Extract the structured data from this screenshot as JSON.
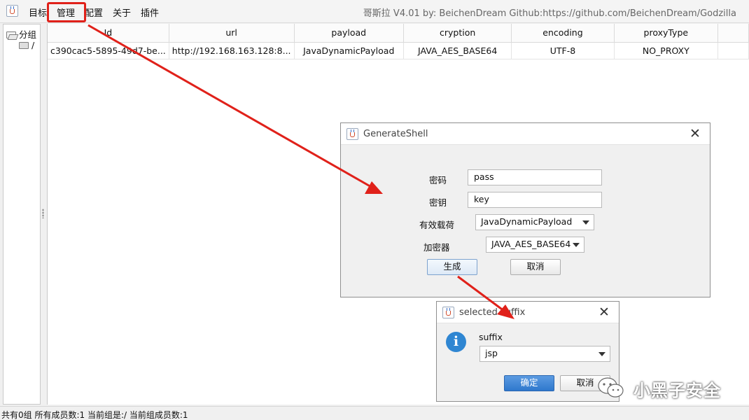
{
  "menubar": {
    "items": [
      "目标",
      "管理",
      "配置",
      "关于",
      "插件"
    ],
    "title_info": "哥斯拉    V4.01 by: BeichenDream Github:https://github.com/BeichenDream/Godzilla"
  },
  "tree": {
    "root": "分组",
    "child": "/"
  },
  "table": {
    "columns": [
      "Id",
      "url",
      "payload",
      "cryption",
      "encoding",
      "proxyType"
    ],
    "rows": [
      [
        "c390cac5-5895-49d7-be...",
        "http://192.168.163.128:8...",
        "JavaDynamicPayload",
        "JAVA_AES_BASE64",
        "UTF-8",
        "NO_PROXY"
      ]
    ]
  },
  "status": "共有0组 所有成员数:1 当前组是:/ 当前组成员数:1",
  "generate_dialog": {
    "title": "GenerateShell",
    "password_label": "密码",
    "password_value": "pass",
    "key_label": "密钥",
    "key_value": "key",
    "payload_label": "有效载荷",
    "payload_value": "JavaDynamicPayload",
    "cryption_label": "加密器",
    "cryption_value": "JAVA_AES_BASE64",
    "generate_button": "生成",
    "cancel_button": "取消"
  },
  "suffix_dialog": {
    "title": "selected suffix",
    "label": "suffix",
    "value": "jsp",
    "ok_button": "确定",
    "cancel_button": "取消"
  },
  "watermark": {
    "text": "小黑子安全"
  },
  "colors": {
    "annotation_red": "#e0211a",
    "primary_button": "#2f78cd",
    "info_icon": "#2f86d2"
  }
}
